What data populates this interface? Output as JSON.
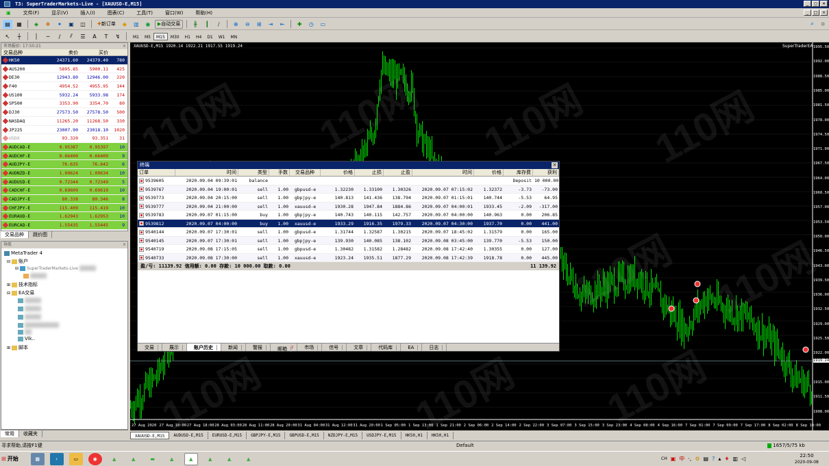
{
  "window": {
    "title": "T3: SuperTraderMarkets-Live - [XAUUSD-E,M15]"
  },
  "menu": [
    "文件(F)",
    "显示(V)",
    "插入(I)",
    "图表(C)",
    "工具(T)",
    "窗口(W)",
    "帮助(H)"
  ],
  "toolbar": {
    "new_order": "新订单",
    "auto_trade": "自动交易",
    "timeframes": [
      "M1",
      "M5",
      "M15",
      "M30",
      "H1",
      "H4",
      "D1",
      "W1",
      "MN"
    ],
    "active_tf": "M15"
  },
  "market_watch": {
    "title": "市场报价: 17:50:21",
    "headers": {
      "symbol": "交易品种",
      "bid": "卖价",
      "ask": "买价",
      "spread": ""
    },
    "rows": [
      {
        "symbol": "HK50",
        "bid": "24371.60",
        "ask": "24379.40",
        "spread": "780",
        "selected": true
      },
      {
        "symbol": "AUS200",
        "bid": "5895.85",
        "ask": "5900.11",
        "spread": "425"
      },
      {
        "symbol": "DE30",
        "bid": "12943.80",
        "ask": "12946.00",
        "spread": "220"
      },
      {
        "symbol": "F40",
        "bid": "4954.52",
        "ask": "4955.95",
        "spread": "144"
      },
      {
        "symbol": "US100",
        "bid": "5932.24",
        "ask": "5933.98",
        "spread": "174"
      },
      {
        "symbol": "SP500",
        "bid": "3353.90",
        "ask": "3354.70",
        "spread": "80"
      },
      {
        "symbol": "DJ30",
        "bid": "27573.50",
        "ask": "27578.50",
        "spread": "500"
      },
      {
        "symbol": "NASDAQ",
        "bid": "11265.20",
        "ask": "11268.50",
        "spread": "330"
      },
      {
        "symbol": "JP225",
        "bid": "23007.90",
        "ask": "23018.10",
        "spread": "1020"
      },
      {
        "symbol": "USDX",
        "bid": "93.320",
        "ask": "93.351",
        "spread": "31",
        "dim": true
      },
      {
        "symbol": "AUDCAD-E",
        "bid": "0.95387",
        "ask": "0.95397",
        "spread": "10",
        "green": true
      },
      {
        "symbol": "AUDCHF-E",
        "bid": "0.66400",
        "ask": "0.66409",
        "spread": "9",
        "green": true
      },
      {
        "symbol": "AUDJPY-E",
        "bid": "76.635",
        "ask": "76.642",
        "spread": "6",
        "green": true
      },
      {
        "symbol": "AUDNZD-E",
        "bid": "1.09624",
        "ask": "1.09634",
        "spread": "10",
        "green": true
      },
      {
        "symbol": "AUDUSD-E",
        "bid": "0.72344",
        "ask": "0.72349",
        "spread": "5",
        "green": true
      },
      {
        "symbol": "CADCHF-E",
        "bid": "0.69609",
        "ask": "0.69619",
        "spread": "10",
        "green": true
      },
      {
        "symbol": "CADJPY-E",
        "bid": "80.338",
        "ask": "80.346",
        "spread": "8",
        "green": true
      },
      {
        "symbol": "CHFJPY-E",
        "bid": "115.409",
        "ask": "115.419",
        "spread": "10",
        "green": true
      },
      {
        "symbol": "EURAUD-E",
        "bid": "1.62943",
        "ask": "1.62953",
        "spread": "10",
        "green": true
      },
      {
        "symbol": "EURCAD-E",
        "bid": "1.55435",
        "ask": "1.55445",
        "spread": "9",
        "green": true
      }
    ],
    "tabs": [
      "交易品种",
      "跳价图"
    ]
  },
  "navigator": {
    "title": "导航",
    "items": [
      "MetaTrader 4",
      "账户",
      "SuperTraderMarkets-Live",
      "技术指标",
      "EA交易",
      "Vik..",
      "脚本"
    ],
    "tabs": [
      "常用",
      "收藏夹"
    ]
  },
  "chart": {
    "title": "XAUUSD-E,M15 1920.14 1922.21 1917.55 1919.24",
    "right_label": "SuperTraderEA",
    "watermark": "110网",
    "y_labels": [
      "1995.50",
      "1992.00",
      "1988.50",
      "1985.00",
      "1981.50",
      "1978.00",
      "1974.50",
      "1971.00",
      "1967.50",
      "1964.00",
      "1960.50",
      "1957.00",
      "1953.50",
      "1950.00",
      "1946.50",
      "1943.00",
      "1939.50",
      "1936.00",
      "1932.50",
      "1929.00",
      "1925.50",
      "1922.00",
      "1919.24",
      "1915.00",
      "1911.50",
      "1908.00"
    ],
    "current_price": "1919.24",
    "x_labels": [
      "27 Aug 2020",
      "27 Aug 10:00",
      "27 Aug 18:00",
      "28 Aug 03:00",
      "28 Aug 11:00",
      "28 Aug 20:00",
      "31 Aug 04:00",
      "31 Aug 12:00",
      "31 Aug 20:00",
      "1 Sep 05:00",
      "1 Sep 13:00",
      "1 Sep 21:00",
      "2 Sep 06:00",
      "2 Sep 14:00",
      "2 Sep 22:00",
      "3 Sep 07:00",
      "3 Sep 15:00",
      "3 Sep 23:00",
      "4 Sep 08:00",
      "4 Sep 16:00",
      "7 Sep 01:00",
      "7 Sep 09:00",
      "7 Sep 17:00",
      "8 Sep 02:00",
      "8 Sep 10:00"
    ],
    "tabs": [
      "XAUUSD-E,M15",
      "AUDUSD-E,M15",
      "EURUSD-E,M15",
      "GBPJPY-E,M15",
      "GBPUSD-E,M15",
      "NZDJPY-E,M15",
      "USDJPY-E,M15",
      "HK50,H1",
      "HK50,H1"
    ]
  },
  "terminal": {
    "title": "终端",
    "headers": [
      "订单",
      "时间",
      "类型",
      "手数",
      "交易品种",
      "价格",
      "止损",
      "止盈",
      "时间",
      "价格",
      "库存费",
      "获利"
    ],
    "rows": [
      {
        "order": "9539605",
        "open_time": "2020.09.04 09:39:01",
        "type": "balance",
        "lots": "",
        "symbol": "",
        "price": "",
        "sl": "",
        "tp": "",
        "close_time": "",
        "close_price": "",
        "swap": "Deposit",
        "profit": "10 000.00",
        "deposit": true
      },
      {
        "order": "9539767",
        "open_time": "2020.09.04 19:00:01",
        "type": "sell",
        "lots": "1.00",
        "symbol": "gbpusd-e",
        "price": "1.32230",
        "sl": "1.33100",
        "tp": "1.30326",
        "close_time": "2020.09.07 07:15:02",
        "close_price": "1.32372",
        "swap": "-3.73",
        "profit": "-73.00"
      },
      {
        "order": "9539773",
        "open_time": "2020.09.04 20:15:00",
        "type": "sell",
        "lots": "1.00",
        "symbol": "gbpjpy-e",
        "price": "140.813",
        "sl": "141.436",
        "tp": "138.794",
        "close_time": "2020.09.07 01:15:01",
        "close_price": "140.744",
        "swap": "-5.53",
        "profit": "64.95"
      },
      {
        "order": "9539777",
        "open_time": "2020.09.04 21:00:00",
        "type": "sell",
        "lots": "1.00",
        "symbol": "xauusd-e",
        "price": "1930.28",
        "sl": "1947.84",
        "tp": "1884.86",
        "close_time": "2020.09.07 04:00:01",
        "close_price": "1933.45",
        "swap": "-2.09",
        "profit": "-317.00"
      },
      {
        "order": "9539783",
        "open_time": "2020.09.07 01:15:00",
        "type": "buy",
        "lots": "1.00",
        "symbol": "gbpjpy-e",
        "price": "140.743",
        "sl": "140.115",
        "tp": "142.757",
        "close_time": "2020.09.07 04:00:00",
        "close_price": "140.963",
        "swap": "0.00",
        "profit": "206.85"
      },
      {
        "order": "9539812",
        "open_time": "2020.09.07 04:00:00",
        "type": "buy",
        "lots": "1.00",
        "symbol": "xauusd-e",
        "price": "1933.29",
        "sl": "1916.35",
        "tp": "1979.33",
        "close_time": "2020.09.07 04:30:00",
        "close_price": "1937.70",
        "swap": "0.00",
        "profit": "441.00",
        "selected": true
      },
      {
        "order": "9540144",
        "open_time": "2020.09.07 17:30:01",
        "type": "sell",
        "lots": "1.00",
        "symbol": "gbpusd-e",
        "price": "1.31744",
        "sl": "1.32587",
        "tp": "1.30215",
        "close_time": "2020.09.07 18:45:02",
        "close_price": "1.31579",
        "swap": "0.00",
        "profit": "165.00"
      },
      {
        "order": "9540145",
        "open_time": "2020.09.07 17:30:01",
        "type": "sell",
        "lots": "1.00",
        "symbol": "gbpjpy-e",
        "price": "139.930",
        "sl": "140.085",
        "tp": "138.102",
        "close_time": "2020.09.08 03:45:00",
        "close_price": "139.770",
        "swap": "-5.53",
        "profit": "150.00"
      },
      {
        "order": "9540719",
        "open_time": "2020.09.08 17:15:05",
        "type": "sell",
        "lots": "1.00",
        "symbol": "gbpusd-e",
        "price": "1.30482",
        "sl": "1.31582",
        "tp": "1.28482",
        "close_time": "2020.09.08 17:42:40",
        "close_price": "1.30355",
        "swap": "0.00",
        "profit": "127.00"
      },
      {
        "order": "9540733",
        "open_time": "2020.09.08 17:30:00",
        "type": "sell",
        "lots": "1.00",
        "symbol": "xauusd-e",
        "price": "1923.24",
        "sl": "1935.51",
        "tp": "1877.29",
        "close_time": "2020.09.08 17:42:39",
        "close_price": "1918.78",
        "swap": "0.00",
        "profit": "445.00"
      }
    ],
    "summary": {
      "label": "盈/亏: 11139.92 信用额: 0.00 存款: 10 000.00 取款: 0.00",
      "total": "11 139.92"
    },
    "tabs": [
      "交易",
      "展示",
      "账户历史",
      "新闻",
      "警报",
      "邮箱",
      "市场",
      "信号",
      "文章",
      "代码库",
      "EA",
      "日志"
    ],
    "active_tab": "账户历史",
    "mail_badge": "2"
  },
  "statusbar": {
    "help": "寻求帮助,请按F1键",
    "profile": "Default",
    "traffic": "1657/5/75 kb"
  },
  "taskbar": {
    "start": "开始",
    "clock_time": "22:50",
    "clock_date": "2020-09-08",
    "ime": "中"
  }
}
